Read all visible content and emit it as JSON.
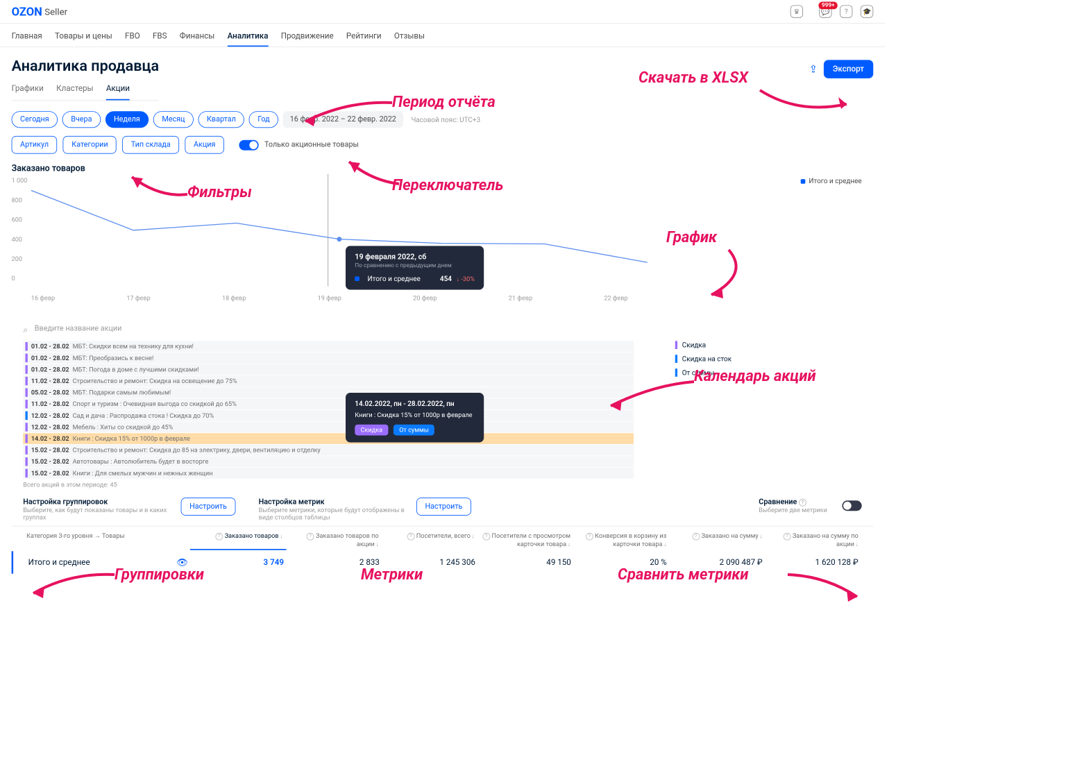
{
  "logo": "OZON",
  "logo_sub": "Seller",
  "badge": "999+",
  "nav": [
    "Главная",
    "Товары и цены",
    "FBO",
    "FBS",
    "Финансы",
    "Аналитика",
    "Продвижение",
    "Рейтинги",
    "Отзывы"
  ],
  "nav_active": 5,
  "page_title": "Аналитика продавца",
  "subtabs": [
    "Графики",
    "Кластеры",
    "Акции"
  ],
  "subtab_active": 2,
  "export_btn": "Экспорт",
  "periods": [
    "Сегодня",
    "Вчера",
    "Неделя",
    "Месяц",
    "Квартал",
    "Год"
  ],
  "period_active": 2,
  "date_from": "16 февр. 2022",
  "date_to": "22 февр. 2022",
  "tz": "Часовой пояс: UTC+3",
  "filters": [
    "Артикул",
    "Категории",
    "Тип склада",
    "Акция"
  ],
  "toggle_label": "Только акционные товары",
  "chart_title": "Заказано товаров",
  "legend_label": "Итого и среднее",
  "chart_data": {
    "type": "line",
    "title": "Заказано товаров",
    "xlabel": "",
    "ylabel": "",
    "ylim": [
      0,
      1000
    ],
    "y_ticks": [
      0,
      200,
      400,
      600,
      800,
      1000
    ],
    "categories": [
      "16 февр",
      "17 февр",
      "18 февр",
      "19 февр",
      "20 февр",
      "21 февр",
      "22 февр"
    ],
    "series": [
      {
        "name": "Итого и среднее",
        "values": [
          910,
          540,
          640,
          454,
          415,
          410,
          240
        ]
      }
    ]
  },
  "tooltip": {
    "title": "19 февраля 2022, сб",
    "sub": "По сравнению с предыдущим днем",
    "label": "Итого и среднее",
    "value": "454",
    "pct": "-30%"
  },
  "search_placeholder": "Введите название акции",
  "gantt": [
    {
      "c": "p",
      "d": "01.02 - 28.02",
      "t": "МБТ: Скидки всем на технику для кухни!"
    },
    {
      "c": "p",
      "d": "01.02 - 28.02",
      "t": "МБТ: Преобразись к весне!"
    },
    {
      "c": "p",
      "d": "01.02 - 28.02",
      "t": "МБТ: Погода в доме с лучшими скидками!"
    },
    {
      "c": "p",
      "d": "11.02 - 28.02",
      "t": "Строительство и ремонт: Скидка на освещение до 75%"
    },
    {
      "c": "p",
      "d": "05.02 - 28.02",
      "t": "МБТ: Подарки самым любимым!"
    },
    {
      "c": "p",
      "d": "11.02 - 28.02",
      "t": "Спорт и туризм : Очевидная выгода со скидкой до 65%"
    },
    {
      "c": "b",
      "d": "12.02 - 28.02",
      "t": "Сад и дача : Распродажа стока ! Скидка до 70%"
    },
    {
      "c": "p",
      "d": "12.02 - 28.02",
      "t": "Мебель : Хиты со скидкой до 45%"
    },
    {
      "c": "p",
      "d": "14.02 - 28.02",
      "t": "Книги : Скидка 15% от 1000р в феврале",
      "sel": true
    },
    {
      "c": "p",
      "d": "15.02 - 28.02",
      "t": "Строительство и ремонт: Скидка до 85 на электрику, двери, вентиляцию и отделку"
    },
    {
      "c": "p",
      "d": "15.02 - 28.02",
      "t": "Автотовары : Автолюбитель будет в восторге"
    },
    {
      "c": "p",
      "d": "15.02 - 28.02",
      "t": "Книги : Для смелых мужчин и нежных женщин"
    }
  ],
  "gantt_legend": [
    "Скидка",
    "Скидка на сток",
    "От суммы"
  ],
  "gantt_total": "Всего акций в этом периоде: 45",
  "gantt_tooltip": {
    "title": "14.02.2022, пн - 28.02.2022, пн",
    "sub": "Книги : Скидка 15% от 1000р в феврале",
    "tag1": "Скидка",
    "tag2": "От суммы"
  },
  "group_title": "Настройка группировок",
  "group_sub": "Выберите, как будут показаны товары и в каких группах",
  "metric_title": "Настройка метрик",
  "metric_sub": "Выберите метрики, которые будут отображены в виде столбцов таблицы",
  "setup_btn": "Настроить",
  "compare_title": "Сравнение",
  "compare_sub": "Выберите две метрики",
  "table_head_first": "Категория 3-го уровня → Товары",
  "columns": [
    "Заказано товаров",
    "Заказано товаров по акции",
    "Посетители, всего",
    "Посетители с просмотром карточки товара",
    "Конверсия в корзину из карточки товара",
    "Заказано на сумму",
    "Заказано на сумму по акции"
  ],
  "row_label": "Итого и среднее",
  "row_values": [
    "3 749",
    "2 833",
    "1 245 306",
    "49 150",
    "20 %",
    "2 090 487 ₽",
    "1 620 128 ₽"
  ],
  "annotations": {
    "export": "Скачать в XLSX",
    "period": "Период  отчёта",
    "filters": "Фильтры",
    "switch": "Переключатель",
    "chart": "График",
    "calendar": "Календарь акций",
    "groups": "Группировки",
    "metrics": "Метрики",
    "compare": "Сравнить метрики"
  }
}
